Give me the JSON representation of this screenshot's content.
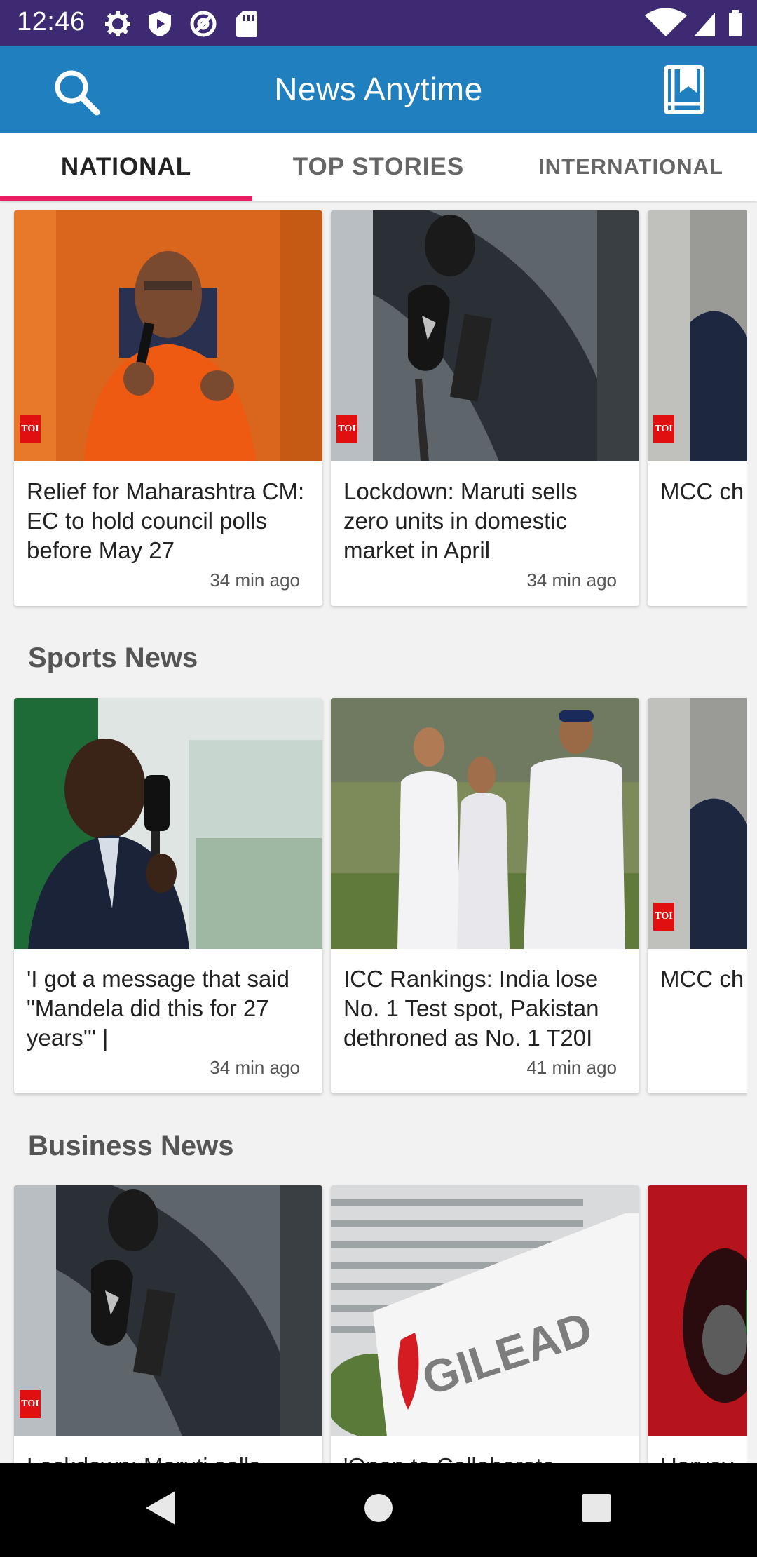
{
  "status_bar": {
    "time": "12:46",
    "left_icons": [
      "gear-icon",
      "shield-play-icon",
      "at-icon",
      "sd-card-icon"
    ],
    "right_icons": [
      "wifi-icon",
      "signal-icon",
      "battery-icon"
    ]
  },
  "app_bar": {
    "title": "News Anytime",
    "left_icon": "search-icon",
    "right_icon": "bookmark-icon"
  },
  "tabs": [
    {
      "label": "NATIONAL",
      "selected": true
    },
    {
      "label": "TOP STORIES",
      "selected": false
    },
    {
      "label": "INTERNATIONAL",
      "selected": false
    }
  ],
  "colors": {
    "status_bar": "#3e2a73",
    "app_bar": "#1f7fbf",
    "tab_indicator": "#e91e63",
    "toi_badge": "#e01010"
  },
  "sections": [
    {
      "title": "",
      "cards": [
        {
          "title": "Relief for Maharashtra CM: EC to hold council polls before May 27",
          "time": "34 min ago",
          "badge": "TOI",
          "image": "man in orange kurta speaking"
        },
        {
          "title": "Lockdown: Maruti sells zero units in domestic market in April",
          "time": "34 min ago",
          "badge": "TOI",
          "image": "car key against car door"
        },
        {
          "title": "MCC ch Sangakl England",
          "time": "",
          "badge": "TOI",
          "image": "man in suit"
        }
      ]
    },
    {
      "title": "Sports News",
      "cards": [
        {
          "title": "'I got a message that said \"Mandela did this for 27 years'\" |",
          "time": "34 min ago",
          "badge": "",
          "image": "man speaking into microphone"
        },
        {
          "title": "ICC Rankings: India lose No. 1 Test spot, Pakistan dethroned as No. 1 T20I",
          "time": "41 min ago",
          "badge": "",
          "image": "cricketers walking"
        },
        {
          "title": "MCC ch Sangakl England",
          "time": "",
          "badge": "TOI",
          "image": "man in suit"
        }
      ]
    },
    {
      "title": "Business News",
      "cards": [
        {
          "title": "Lockdown: Maruti sells",
          "time": "",
          "badge": "TOI",
          "image": "car key against car door"
        },
        {
          "title": "'Open to Collaborate",
          "time": "",
          "badge": "",
          "image": "Gilead sign"
        },
        {
          "title": "Harvey",
          "time": "",
          "badge": "",
          "image": "red car fuel cap"
        }
      ]
    }
  ],
  "gilead_sign": "GILEAD",
  "nav_bar": {
    "icons": [
      "back-icon",
      "home-icon",
      "recents-icon"
    ]
  }
}
